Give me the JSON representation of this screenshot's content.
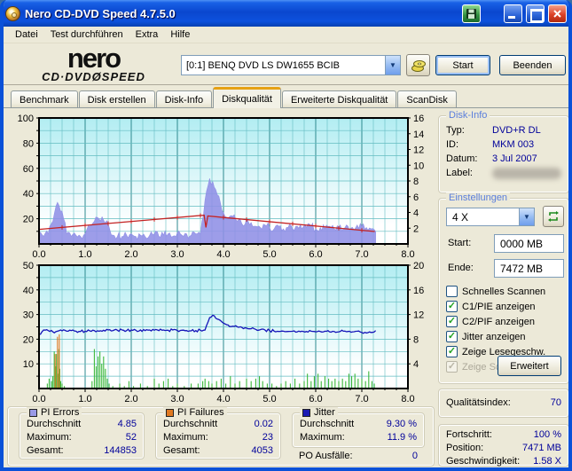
{
  "window": {
    "title": "Nero CD-DVD Speed 4.7.5.0"
  },
  "menu": {
    "items": [
      "Datei",
      "Test durchführen",
      "Extra",
      "Hilfe"
    ]
  },
  "header": {
    "logo_line1": "nero",
    "logo_line2": "CD·DVDØSPEED",
    "drive_selector": "[0:1]   BENQ DVD LS DW1655 BCIB",
    "start_label": "Start",
    "quit_label": "Beenden"
  },
  "tabs": {
    "labels": [
      "Benchmark",
      "Disk erstellen",
      "Disk-Info",
      "Diskqualität",
      "Erweiterte Diskqualität",
      "ScanDisk"
    ],
    "active": "Diskqualität"
  },
  "disk_info": {
    "title": "Disk-Info",
    "rows": [
      {
        "label": "Typ:",
        "value": "DVD+R DL"
      },
      {
        "label": "ID:",
        "value": "MKM 003"
      },
      {
        "label": "Datum:",
        "value": "3 Jul 2007"
      },
      {
        "label": "Label:",
        "value": ""
      }
    ]
  },
  "settings": {
    "title": "Einstellungen",
    "speed_value": "4 X",
    "start_label": "Start:",
    "start_value": "0000 MB",
    "end_label": "Ende:",
    "end_value": "7472 MB",
    "checkboxes": [
      {
        "label": "Schnelles Scannen",
        "checked": false,
        "enabled": true
      },
      {
        "label": "C1/PIE anzeigen",
        "checked": true,
        "enabled": true
      },
      {
        "label": "C2/PIF anzeigen",
        "checked": true,
        "enabled": true
      },
      {
        "label": "Jitter anzeigen",
        "checked": true,
        "enabled": true
      },
      {
        "label": "Zeige Lesegeschw.",
        "checked": true,
        "enabled": true
      },
      {
        "label": "Zeige Schreibgeschw.",
        "checked": true,
        "enabled": false
      }
    ],
    "advanced_label": "Erweitert"
  },
  "quality": {
    "label": "Qualitätsindex:",
    "value": "70"
  },
  "progress": {
    "rows": [
      {
        "label": "Fortschritt:",
        "value": "100 %"
      },
      {
        "label": "Position:",
        "value": "7471 MB"
      },
      {
        "label": "Geschwindigkeit:",
        "value": "1.58 X"
      }
    ]
  },
  "stats": {
    "pi_errors": {
      "title": "PI Errors",
      "color": "#9a9ae6",
      "rows": [
        {
          "label": "Durchschnitt",
          "value": "4.85"
        },
        {
          "label": "Maximum:",
          "value": "52"
        },
        {
          "label": "Gesamt:",
          "value": "144853"
        }
      ]
    },
    "pi_failures": {
      "title": "PI Failures",
      "color": "#e07820",
      "rows": [
        {
          "label": "Durchschnitt",
          "value": "0.02"
        },
        {
          "label": "Maximum:",
          "value": "23"
        },
        {
          "label": "Gesamt:",
          "value": "4053"
        }
      ]
    },
    "jitter": {
      "title": "Jitter",
      "color": "#1a1ab4",
      "rows": [
        {
          "label": "Durchschnitt",
          "value": "9.30 %"
        },
        {
          "label": "Maximum:",
          "value": "11.9 %"
        }
      ],
      "extra": {
        "label": "PO Ausfälle:",
        "value": "0"
      }
    }
  },
  "colors": {
    "pie_area": "#8f8fe6",
    "speed_line": "#c42222",
    "pif_spikes": "#3cb83c",
    "po_spikes": "#e07820",
    "jitter_line": "#1414b8",
    "grid_minor": "#63bcc1",
    "grid_major": "#2e8a8f",
    "plot_bg_top": "#b2edf2",
    "plot_bg_bottom": "#ffffff"
  },
  "chart_data": [
    {
      "type": "area",
      "name": "pi-errors-and-speed",
      "x_axis": {
        "min": 0,
        "max": 8,
        "grid_step": 0.25,
        "major_step": 1,
        "label_step": 1,
        "labels": [
          "0.0",
          "1.0",
          "2.0",
          "3.0",
          "4.0",
          "5.0",
          "6.0",
          "7.0",
          "8.0"
        ]
      },
      "left_axis": {
        "min": 0,
        "max": 100,
        "grid_step": 10,
        "label_step": 20,
        "labels": [
          "20",
          "40",
          "60",
          "80",
          "100"
        ]
      },
      "right_axis": {
        "min": 0,
        "max": 16,
        "label_step": 2,
        "labels": [
          "2",
          "4",
          "6",
          "8",
          "10",
          "12",
          "14",
          "16"
        ]
      },
      "series": [
        {
          "name": "PI Errors",
          "kind": "area",
          "axis": "left",
          "color": "#8f8fe6",
          "noise": 3.2,
          "x0": 0,
          "dx": 0.1,
          "values": [
            9,
            6,
            8,
            18,
            33,
            26,
            8,
            6,
            7,
            6,
            8,
            14,
            18,
            20,
            19,
            16,
            7,
            6,
            6,
            7,
            8,
            6,
            7,
            6,
            7,
            8,
            6,
            7,
            8,
            6,
            9,
            7,
            8,
            7,
            8,
            8,
            35,
            52,
            45,
            38,
            25,
            20,
            22,
            18,
            16,
            20,
            17,
            14,
            13,
            15,
            13,
            12,
            14,
            12,
            13,
            12,
            14,
            12,
            13,
            14,
            12,
            13,
            12,
            14,
            12,
            13,
            12,
            14,
            13,
            15,
            14,
            13,
            12,
            10
          ]
        },
        {
          "name": "Lesegeschwindigkeit",
          "kind": "line",
          "axis": "right",
          "color": "#c42222",
          "noise": 0,
          "ticks": 0.5,
          "points": [
            [
              0,
              1.85
            ],
            [
              3.58,
              3.65
            ],
            [
              3.62,
              2.1
            ],
            [
              3.66,
              3.55
            ],
            [
              7.28,
              1.58
            ]
          ]
        }
      ]
    },
    {
      "type": "line",
      "name": "jitter-and-pi-failures",
      "x_axis": {
        "min": 0,
        "max": 8,
        "grid_step": 0.25,
        "major_step": 1,
        "label_step": 1,
        "labels": [
          "0.0",
          "1.0",
          "2.0",
          "3.0",
          "4.0",
          "5.0",
          "6.0",
          "7.0",
          "8.0"
        ]
      },
      "left_axis": {
        "min": 0,
        "max": 50,
        "grid_step": 5,
        "label_step": 10,
        "labels": [
          "10",
          "20",
          "30",
          "40",
          "50"
        ]
      },
      "right_axis": {
        "min": 0,
        "max": 20,
        "label_step": 4,
        "labels": [
          "4",
          "8",
          "12",
          "16",
          "20"
        ]
      },
      "series": [
        {
          "name": "PI Failures",
          "kind": "spikes",
          "axis": "left",
          "color": "#3cb83c",
          "points": [
            [
              0.18,
              2
            ],
            [
              0.22,
              4
            ],
            [
              0.27,
              3
            ],
            [
              0.3,
              5
            ],
            [
              0.33,
              15
            ],
            [
              0.36,
              9
            ],
            [
              0.38,
              14
            ],
            [
              0.41,
              6
            ],
            [
              0.43,
              16
            ],
            [
              0.45,
              8
            ],
            [
              0.47,
              3
            ],
            [
              0.5,
              2
            ],
            [
              0.55,
              1
            ],
            [
              1.15,
              3
            ],
            [
              1.2,
              16
            ],
            [
              1.24,
              9
            ],
            [
              1.28,
              13
            ],
            [
              1.32,
              15
            ],
            [
              1.36,
              10
            ],
            [
              1.4,
              13
            ],
            [
              1.44,
              8
            ],
            [
              1.48,
              4
            ],
            [
              1.52,
              2
            ],
            [
              1.6,
              1
            ],
            [
              1.75,
              2
            ],
            [
              1.85,
              1
            ],
            [
              1.95,
              3
            ],
            [
              2.05,
              1
            ],
            [
              2.2,
              2
            ],
            [
              2.35,
              1
            ],
            [
              2.5,
              4
            ],
            [
              2.6,
              2
            ],
            [
              2.7,
              3
            ],
            [
              2.8,
              4
            ],
            [
              2.9,
              1
            ],
            [
              3.0,
              2
            ],
            [
              3.15,
              1
            ],
            [
              3.3,
              2
            ],
            [
              3.45,
              2
            ],
            [
              3.55,
              3
            ],
            [
              3.6,
              4
            ],
            [
              3.68,
              3
            ],
            [
              3.75,
              2
            ],
            [
              3.85,
              3
            ],
            [
              3.95,
              4
            ],
            [
              4.05,
              2
            ],
            [
              4.15,
              5
            ],
            [
              4.25,
              2
            ],
            [
              4.35,
              3
            ],
            [
              4.5,
              4
            ],
            [
              4.6,
              3
            ],
            [
              4.7,
              4
            ],
            [
              4.78,
              5
            ],
            [
              4.85,
              3
            ],
            [
              4.95,
              2
            ],
            [
              5.05,
              2
            ],
            [
              5.15,
              1
            ],
            [
              5.25,
              2
            ],
            [
              5.35,
              3
            ],
            [
              5.45,
              2
            ],
            [
              5.55,
              4
            ],
            [
              5.65,
              2
            ],
            [
              5.75,
              3
            ],
            [
              5.82,
              6
            ],
            [
              5.9,
              3
            ],
            [
              5.97,
              5
            ],
            [
              6.05,
              6
            ],
            [
              6.12,
              3
            ],
            [
              6.2,
              5
            ],
            [
              6.28,
              4
            ],
            [
              6.35,
              3
            ],
            [
              6.42,
              4
            ],
            [
              6.5,
              3
            ],
            [
              6.58,
              4
            ],
            [
              6.65,
              3
            ],
            [
              6.72,
              6
            ],
            [
              6.78,
              5
            ],
            [
              6.85,
              6
            ],
            [
              6.92,
              4
            ],
            [
              7.0,
              4
            ],
            [
              7.08,
              3
            ],
            [
              7.15,
              7
            ],
            [
              7.22,
              3
            ],
            [
              7.27,
              2
            ]
          ]
        },
        {
          "name": "PO Failures",
          "kind": "spikes",
          "axis": "left",
          "color": "#e07820",
          "points": [
            [
              0.35,
              14
            ],
            [
              0.4,
              21
            ],
            [
              0.44,
              22
            ]
          ]
        },
        {
          "name": "Jitter",
          "kind": "line",
          "axis": "right",
          "color": "#1414b8",
          "noise": 0.22,
          "x0": 0,
          "dx": 0.1,
          "values": [
            8.8,
            9.5,
            9.4,
            9.2,
            9.3,
            9.35,
            9.3,
            9.4,
            9.3,
            9.25,
            9.3,
            9.35,
            9.4,
            9.3,
            9.45,
            9.5,
            9.4,
            9.45,
            9.5,
            9.4,
            9.5,
            9.45,
            9.5,
            9.4,
            9.5,
            9.45,
            9.4,
            9.5,
            9.45,
            9.5,
            9.4,
            9.45,
            9.4,
            9.35,
            9.4,
            9.45,
            9.5,
            11.5,
            11.8,
            11.2,
            10.6,
            10.3,
            10.1,
            10.0,
            9.9,
            9.8,
            9.7,
            9.6,
            9.55,
            9.5,
            9.4,
            9.3,
            9.25,
            9.3,
            9.25,
            9.3,
            9.2,
            9.3,
            9.25,
            9.3,
            9.2,
            9.25,
            9.3,
            9.2,
            9.25,
            9.2,
            9.3,
            9.25,
            9.2,
            9.3,
            9.1,
            9.0,
            9.1,
            9.4
          ]
        }
      ]
    }
  ]
}
